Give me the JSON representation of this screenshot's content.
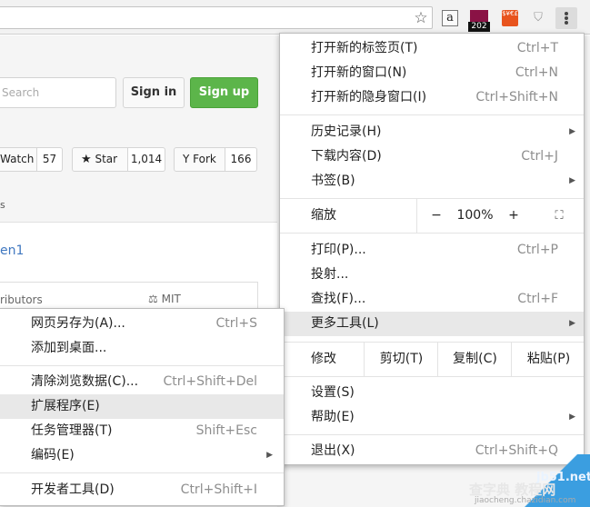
{
  "toolbar": {
    "ext_amazon_glyph": "a",
    "ext_badge": "202",
    "ext_orange_glyph": "$¥€£"
  },
  "page": {
    "search_placeholder": "Search",
    "signin": "Sign in",
    "signup": "Sign up",
    "watch_label": "Watch",
    "watch_count": "57",
    "star_label": "Star",
    "star_count": "1,014",
    "fork_label": "Fork",
    "fork_count": "166",
    "frag_s": "s",
    "frag_en1": "en1",
    "frag_contrib": "ributors",
    "frag_mit": "MIT"
  },
  "main_menu": {
    "new_tab": {
      "label": "打开新的标签页(T)",
      "shortcut": "Ctrl+T"
    },
    "new_window": {
      "label": "打开新的窗口(N)",
      "shortcut": "Ctrl+N"
    },
    "incognito": {
      "label": "打开新的隐身窗口(I)",
      "shortcut": "Ctrl+Shift+N"
    },
    "history": {
      "label": "历史记录(H)"
    },
    "downloads": {
      "label": "下载内容(D)",
      "shortcut": "Ctrl+J"
    },
    "bookmarks": {
      "label": "书签(B)"
    },
    "zoom": {
      "label": "缩放",
      "minus": "−",
      "level": "100%",
      "plus": "+"
    },
    "print": {
      "label": "打印(P)...",
      "shortcut": "Ctrl+P"
    },
    "cast": {
      "label": "投射..."
    },
    "find": {
      "label": "查找(F)...",
      "shortcut": "Ctrl+F"
    },
    "more_tools": {
      "label": "更多工具(L)"
    },
    "edit": {
      "label": "修改",
      "cut": "剪切(T)",
      "copy": "复制(C)",
      "paste": "粘贴(P)"
    },
    "settings": {
      "label": "设置(S)"
    },
    "help": {
      "label": "帮助(E)"
    },
    "exit": {
      "label": "退出(X)",
      "shortcut": "Ctrl+Shift+Q"
    }
  },
  "sub_menu": {
    "save_page": {
      "label": "网页另存为(A)...",
      "shortcut": "Ctrl+S"
    },
    "add_desktop": {
      "label": "添加到桌面..."
    },
    "clear_data": {
      "label": "清除浏览数据(C)...",
      "shortcut": "Ctrl+Shift+Del"
    },
    "extensions": {
      "label": "扩展程序(E)"
    },
    "task_manager": {
      "label": "任务管理器(T)",
      "shortcut": "Shift+Esc"
    },
    "encoding": {
      "label": "编码(E)"
    },
    "dev_tools": {
      "label": "开发者工具(D)",
      "shortcut": "Ctrl+Shift+I"
    }
  },
  "watermark": {
    "site": "jb51.net",
    "name": "查字典 教程网",
    "url": "jiaocheng.chazidian.com"
  }
}
